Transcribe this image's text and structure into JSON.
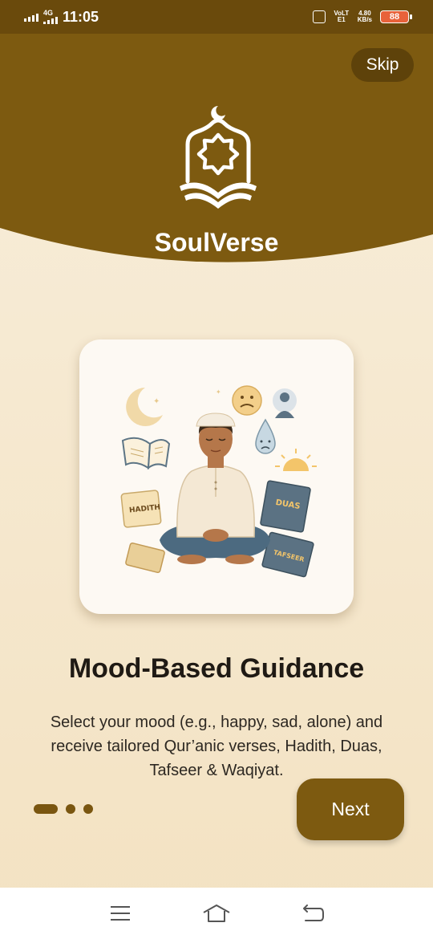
{
  "status_bar": {
    "network": "4G",
    "time": "11:05",
    "volte": "VoLTE1",
    "speed_value": "4.80",
    "speed_unit": "KB/s",
    "battery": "88"
  },
  "header": {
    "skip_label": "Skip",
    "brand": "SoulVerse",
    "logo_icon": "mosque-book-logo-icon"
  },
  "illustration": {
    "icon": "meditating-man-illustration",
    "labels": {
      "hadith": "HADITH",
      "duas": "DUAS",
      "tafseer": "TAFSEER"
    }
  },
  "onboarding": {
    "title": "Mood-Based Guidance",
    "description": "Select your mood (e.g., happy, sad, alone) and receive tailored Qur’anic verses, Hadith, Duas, Tafseer & Waqiyat.",
    "page_index": 1,
    "page_count": 3,
    "next_label": "Next"
  },
  "nav_bar": {
    "menu_icon": "menu-icon",
    "home_icon": "home-icon",
    "back_icon": "back-icon"
  },
  "colors": {
    "primary": "#7d5a10",
    "status_bar": "#6a4a0c",
    "background": "#f8eedb"
  }
}
